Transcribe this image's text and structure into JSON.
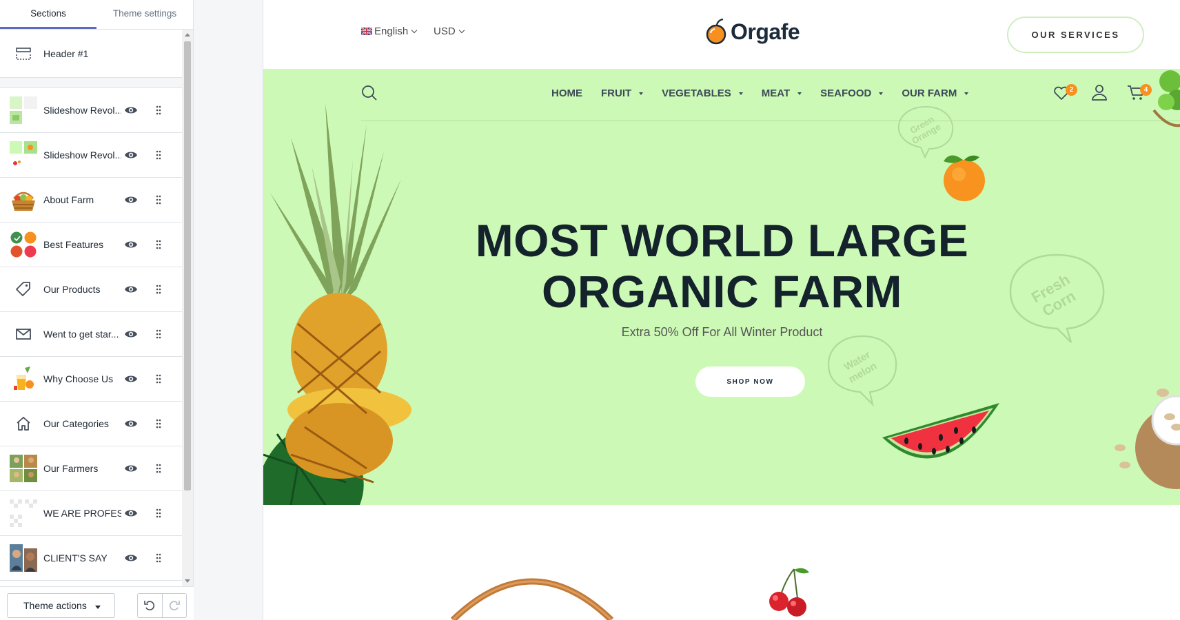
{
  "sidebar": {
    "tabs": [
      {
        "label": "Sections",
        "active": true
      },
      {
        "label": "Theme settings",
        "active": false
      }
    ],
    "header_section": {
      "label": "Header #1",
      "icon": "header-layout-icon"
    },
    "sections": [
      {
        "label": "Slideshow Revol...",
        "thumb": "slideshow-thumb-1"
      },
      {
        "label": "Slideshow Revol...",
        "thumb": "slideshow-thumb-2"
      },
      {
        "label": "About Farm",
        "thumb": "basket-thumb"
      },
      {
        "label": "Best Features",
        "thumb": "features-thumb"
      },
      {
        "label": "Our Products",
        "thumb": "tag-icon"
      },
      {
        "label": "Went to get star...",
        "thumb": "envelope-icon"
      },
      {
        "label": "Why Choose Us",
        "thumb": "juice-thumb"
      },
      {
        "label": "Our Categories",
        "thumb": "home-icon"
      },
      {
        "label": "Our Farmers",
        "thumb": "farmers-thumb"
      },
      {
        "label": "WE ARE PROFES...",
        "thumb": "transparent-thumb"
      },
      {
        "label": "CLIENT'S SAY",
        "thumb": "clients-thumb"
      }
    ],
    "theme_actions_label": "Theme actions"
  },
  "store": {
    "language": "English",
    "currency": "USD",
    "brand": "Orgafe",
    "services_button": "OUR SERVICES",
    "nav": [
      "HOME",
      "FRUIT",
      "VEGETABLES",
      "MEAT",
      "SEAFOOD",
      "OUR FARM"
    ],
    "wishlist_count": "2",
    "cart_count": "4",
    "hero": {
      "title_line1": "MOST WORLD LARGE",
      "title_line2": "ORGANIC FARM",
      "subtitle": "Extra 50% Off For All Winter Product",
      "button": "SHOP NOW",
      "bubbles": [
        {
          "line1": "Green",
          "line2": "Orange"
        },
        {
          "line1": "Fresh",
          "line2": "Corn"
        },
        {
          "line1": "Water",
          "line2": "melon"
        }
      ]
    }
  },
  "colors": {
    "hero_bg": "#cdf9b6",
    "accent_orange": "#f7901e",
    "tab_active": "#5c6ac4",
    "heading": "#14222c"
  }
}
